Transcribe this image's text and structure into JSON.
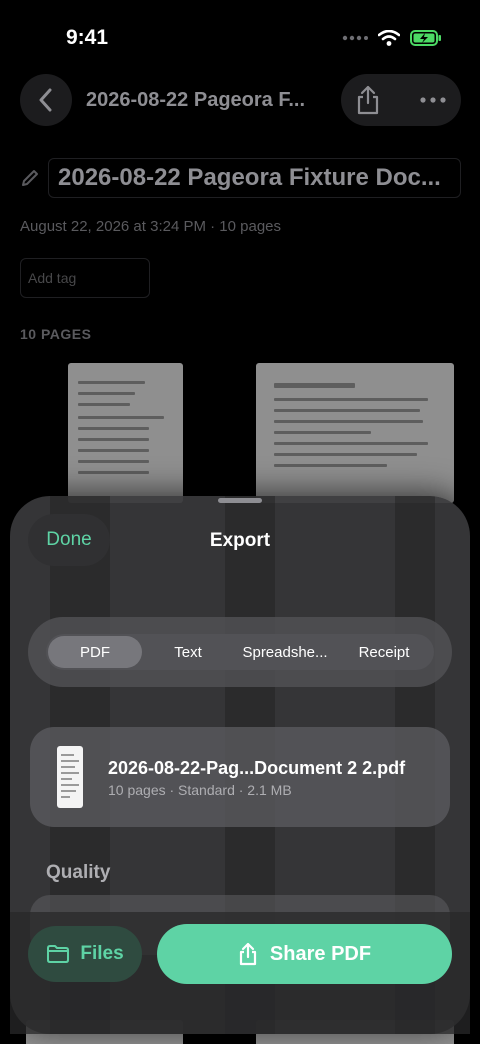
{
  "status": {
    "time": "9:41"
  },
  "doc": {
    "nav_title": "2026-08-22 Pageora F...",
    "title": "2026-08-22 Pageora Fixture Doc...",
    "meta": "August 22, 2026 at 3:24 PM · 10 pages",
    "tag_placeholder": "Add tag",
    "pages_label": "10 PAGES"
  },
  "sheet": {
    "done": "Done",
    "title": "Export",
    "formats": [
      "PDF",
      "Text",
      "Spreadshe...",
      "Receipt"
    ],
    "selected_format": "PDF",
    "file": {
      "name": "2026-08-22-Pag...Document 2 2.pdf",
      "meta": "10 pages · Standard · 2.1 MB"
    },
    "quality_label": "Quality",
    "files_button": "Files",
    "share_button": "Share PDF"
  },
  "icons": [
    "chevron-left-icon",
    "share-icon",
    "more-icon",
    "pencil-icon",
    "folder-icon",
    "signal-icon",
    "wifi-icon",
    "battery-icon"
  ],
  "colors": {
    "accent": "#5ed3a5",
    "sheet": "#3a3a3c"
  }
}
